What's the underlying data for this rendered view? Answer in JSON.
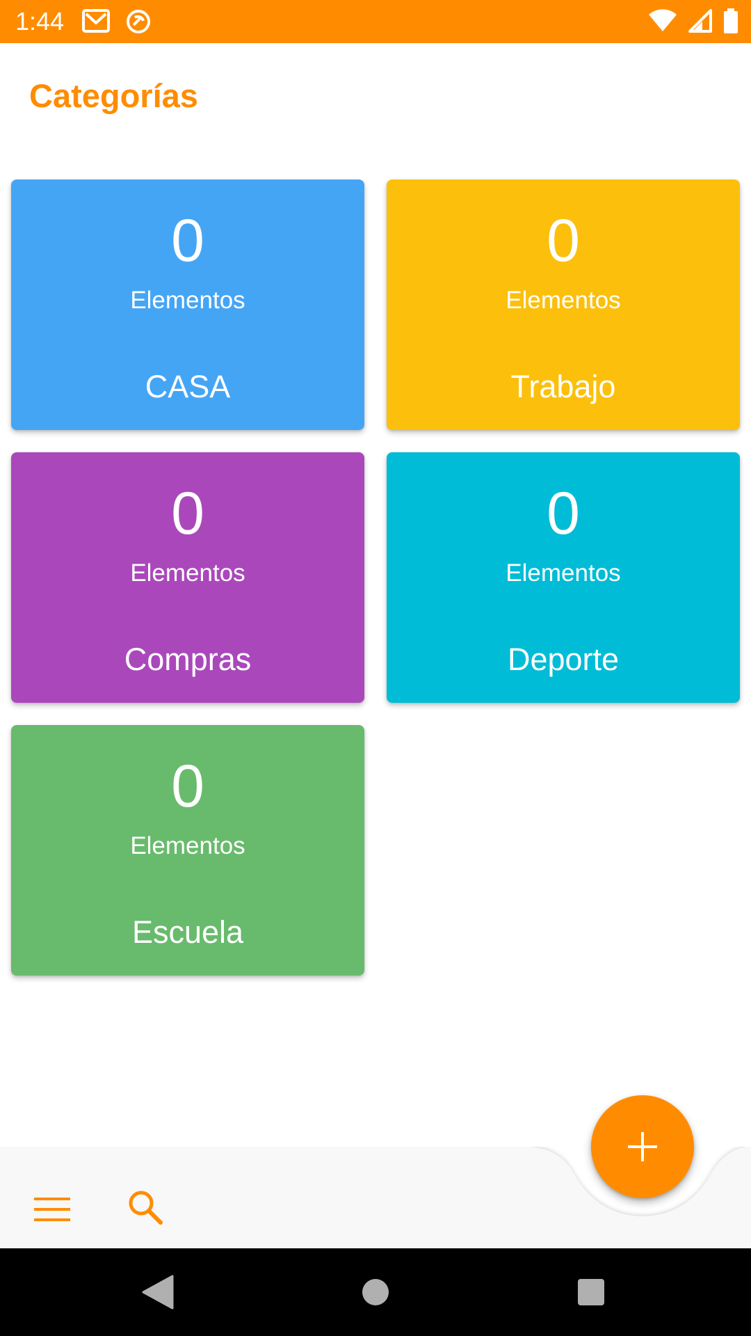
{
  "status_bar": {
    "time": "1:44",
    "icons": [
      "gmail-icon",
      "sync-icon",
      "wifi-icon",
      "signal-icon",
      "battery-icon"
    ]
  },
  "header": {
    "title": "Categorías"
  },
  "categories": [
    {
      "count": "0",
      "count_label": "Elementos",
      "name": "CASA",
      "color": "#45A5F5"
    },
    {
      "count": "0",
      "count_label": "Elementos",
      "name": "Trabajo",
      "color": "#FCC00C"
    },
    {
      "count": "0",
      "count_label": "Elementos",
      "name": "Compras",
      "color": "#AA48BB"
    },
    {
      "count": "0",
      "count_label": "Elementos",
      "name": "Deporte",
      "color": "#00BCD6"
    },
    {
      "count": "0",
      "count_label": "Elementos",
      "name": "Escuela",
      "color": "#68BB6C"
    }
  ],
  "bottom_bar": {
    "icons": [
      "menu-icon",
      "search-icon"
    ]
  },
  "fab": {
    "icon": "plus-icon"
  },
  "nav_bar": {
    "icons": [
      "back-icon",
      "home-icon",
      "recents-icon"
    ]
  },
  "theme": {
    "accent": "#FF8C00",
    "bar_background": "#F8F8F8",
    "nav_background": "#000000"
  }
}
